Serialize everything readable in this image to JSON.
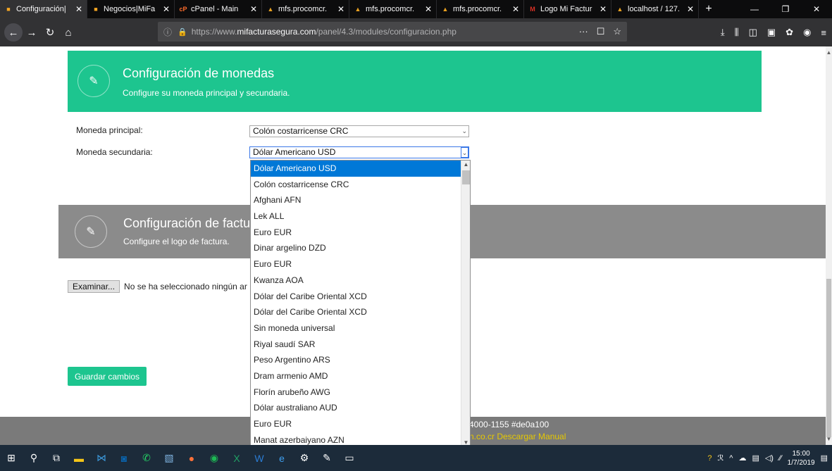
{
  "browser": {
    "tabs": [
      {
        "title": "Configuración|",
        "favicon": "mifactura-favicon",
        "active": true
      },
      {
        "title": "Negocios|MiFa",
        "favicon": "mifactura-favicon",
        "active": false
      },
      {
        "title": "cPanel - Main",
        "favicon": "cpanel-favicon",
        "active": false
      },
      {
        "title": "mfs.procomcr.",
        "favicon": "procomcr-favicon",
        "active": false
      },
      {
        "title": "mfs.procomcr.",
        "favicon": "procomcr-favicon",
        "active": false
      },
      {
        "title": "mfs.procomcr.",
        "favicon": "procomcr-favicon",
        "active": false
      },
      {
        "title": "Logo Mi Factur",
        "favicon": "gmail-favicon",
        "active": false
      },
      {
        "title": "localhost / 127.",
        "favicon": "procomcr-favicon",
        "active": false
      }
    ],
    "url_prefix": "https://www.",
    "url_domain": "mifacturasegura.com",
    "url_path": "/panel/4.3/modules/configuracion.php"
  },
  "currency_panel": {
    "title": "Configuración de monedas",
    "subtitle": "Configure su moneda principal y secundaria.",
    "color": "#1dc58f"
  },
  "form": {
    "primary_label": "Moneda principal:",
    "primary_value": "Colón costarricense CRC",
    "secondary_label": "Moneda secundaria:",
    "secondary_value": "Dólar Americano USD"
  },
  "dropdown": {
    "options": [
      "Dólar Americano USD",
      "Colón costarricense CRC",
      "Afghani AFN",
      "Lek ALL",
      "Euro EUR",
      "Dinar argelino DZD",
      "Euro EUR",
      "Kwanza AOA",
      "Dólar del Caribe Oriental XCD",
      "Dólar del Caribe Oriental XCD",
      "Sin moneda universal",
      "Riyal saudí SAR",
      "Peso Argentino ARS",
      "Dram armenio AMD",
      "Florín arubeño AWG",
      "Dólar australiano AUD",
      "Euro EUR",
      "Manat azerbaiyano AZN"
    ],
    "selected_index": 0
  },
  "invoice_panel": {
    "title": "Configuración de factura",
    "subtitle": "Configure el logo de factura.",
    "color": "#8b8b8b"
  },
  "file_input": {
    "button_label": "Examinar...",
    "status": "No se ha seleccionado ningún ar"
  },
  "save_button": {
    "label": "Guardar cambios"
  },
  "footer": {
    "line1": "4000-1155 #de0a100",
    "line2": "n.co.cr Descargar Manual"
  },
  "taskbar": {
    "time": "15:00",
    "date": "1/7/2019"
  }
}
